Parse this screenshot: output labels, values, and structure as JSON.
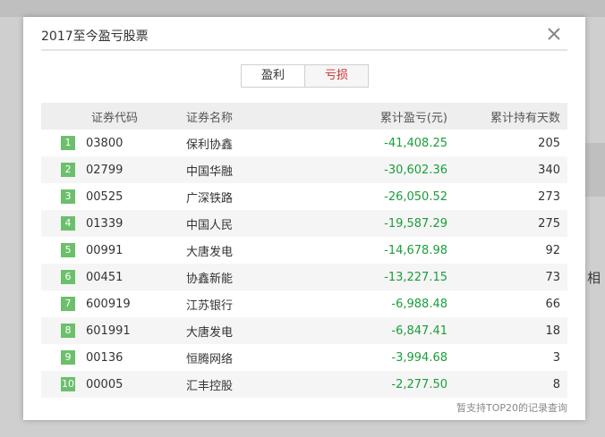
{
  "modal": {
    "title": "2017至今盈亏股票",
    "close_icon": "close-icon"
  },
  "tabs": [
    {
      "label": "盈利",
      "active": false
    },
    {
      "label": "亏损",
      "active": true
    }
  ],
  "table": {
    "headers": {
      "code": "证券代码",
      "name": "证券名称",
      "pl": "累计盈亏(元)",
      "days": "累计持有天数"
    },
    "rows": [
      {
        "rank": "1",
        "code": "03800",
        "name": "保利协鑫",
        "pl": "-41,408.25",
        "days": "205"
      },
      {
        "rank": "2",
        "code": "02799",
        "name": "中国华融",
        "pl": "-30,602.36",
        "days": "340"
      },
      {
        "rank": "3",
        "code": "00525",
        "name": "广深铁路",
        "pl": "-26,050.52",
        "days": "273"
      },
      {
        "rank": "4",
        "code": "01339",
        "name": "中国人民",
        "pl": "-19,587.29",
        "days": "275"
      },
      {
        "rank": "5",
        "code": "00991",
        "name": "大唐发电",
        "pl": "-14,678.98",
        "days": "92"
      },
      {
        "rank": "6",
        "code": "00451",
        "name": "协鑫新能",
        "pl": "-13,227.15",
        "days": "73"
      },
      {
        "rank": "7",
        "code": "600919",
        "name": "江苏银行",
        "pl": "-6,988.48",
        "days": "66"
      },
      {
        "rank": "8",
        "code": "601991",
        "name": "大唐发电",
        "pl": "-6,847.41",
        "days": "18"
      },
      {
        "rank": "9",
        "code": "00136",
        "name": "恒腾网络",
        "pl": "-3,994.68",
        "days": "3"
      },
      {
        "rank": "10",
        "code": "00005",
        "name": "汇丰控股",
        "pl": "-2,277.50",
        "days": "8"
      }
    ]
  },
  "footnote": "暂支持TOP20的记录查询",
  "colors": {
    "loss": "#1a9e3a",
    "rank_badge": "#6cc06c",
    "active_tab": "#d02a2a"
  }
}
